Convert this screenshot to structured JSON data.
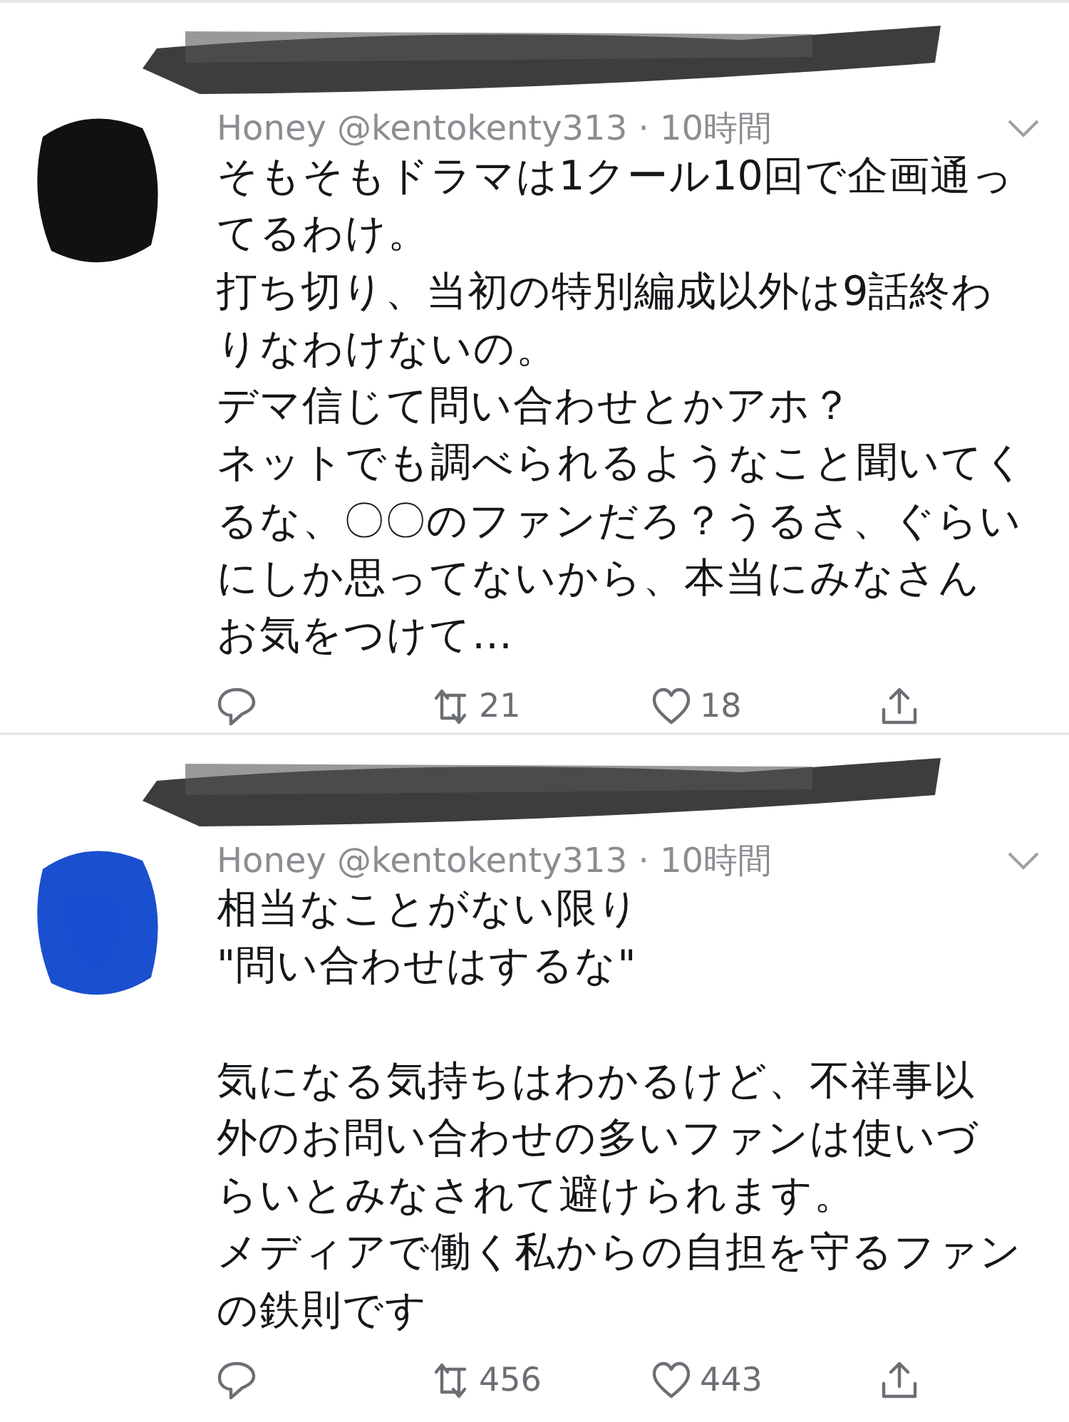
{
  "tweets": [
    {
      "author": "Honey @kentokenty313 · 10時間",
      "color": "#111111",
      "paragraphs": [
        [
          "そもそもドラマは1クール10回で企画通っ",
          "てるわけ。",
          "打ち切り、当初の特別編成以外は9話終わ",
          "りなわけないの。",
          "デマ信じて問い合わせとかアホ？",
          "ネットでも調べられるようなこと聞いてく",
          "るな、〇〇のファンだろ？うるさ、ぐらい",
          "にしか思ってないから、本当にみなさん",
          "お気をつけて…"
        ]
      ],
      "retweets": "21",
      "likes": "18"
    },
    {
      "author": "Honey @kentokenty313 · 10時間",
      "color": "#1a4fd0",
      "paragraphs": [
        [
          "相当なことがない限り",
          "\"問い合わせはするな\""
        ],
        [
          "気になる気持ちはわかるけど、不祥事以",
          "外のお問い合わせの多いファンは使いづ",
          "らいとみなされて避けられます。",
          "メディアで働く私からの自担を守るファン",
          "の鉄則です"
        ]
      ],
      "retweets": "456",
      "likes": "443"
    }
  ]
}
